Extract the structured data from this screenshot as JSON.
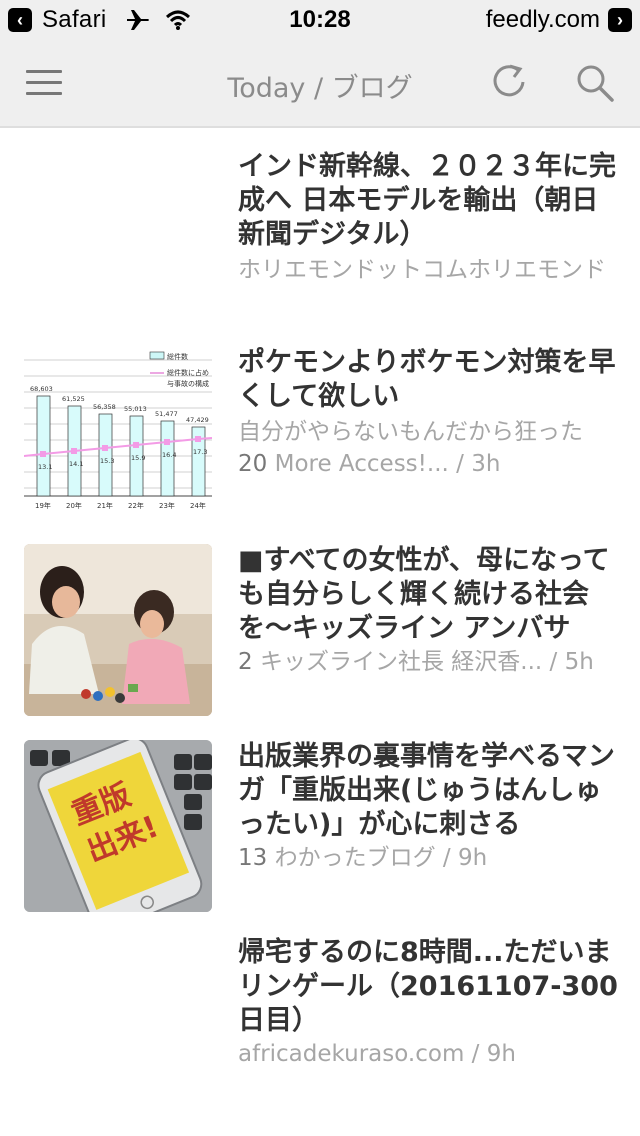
{
  "status_bar": {
    "back_app": "Safari",
    "time": "10:28",
    "domain": "feedly.com"
  },
  "nav": {
    "title": "Today / ブログ"
  },
  "articles": [
    {
      "title": "インド新幹線、２０２３年に完成へ 日本モデルを輸出（朝日新聞デジタル）",
      "snippet": "ホリエモンドットコムホリエモンド"
    },
    {
      "title": "ポケモンよりボケモン対策を早くして欲しい",
      "snippet": "自分がやらないもんだから狂った",
      "count": "20",
      "source": "More Access!...",
      "age": "3h",
      "chart_labels": {
        "legend1": "総件数",
        "legend2": "総件数に占め",
        "legend3": "与事故の構成",
        "values": [
          "68,603",
          "61,525",
          "56,358",
          "55,013",
          "51,477",
          "47,429"
        ],
        "rates": [
          "13.1",
          "14.1",
          "15.3",
          "15.9",
          "16.4",
          "17.3"
        ],
        "years": [
          "19年",
          "20年",
          "21年",
          "22年",
          "23年",
          "24年"
        ]
      }
    },
    {
      "title": "■すべての女性が、母になっても自分らしく輝く続ける社会を〜キッズライン アンバサ",
      "count": "2",
      "source": "キッズライン社長 経沢香...",
      "age": "5h"
    },
    {
      "title": "出版業界の裏事情を学べるマンガ「重版出来(じゅうはんしゅったい)」が心に刺さる",
      "count": "13",
      "source": "わかったブログ",
      "age": "9h"
    },
    {
      "title": "帰宅するのに8時間...ただいまリンゲール（20161107-300日目）",
      "source": "africadekuraso.com",
      "age": "9h"
    }
  ]
}
